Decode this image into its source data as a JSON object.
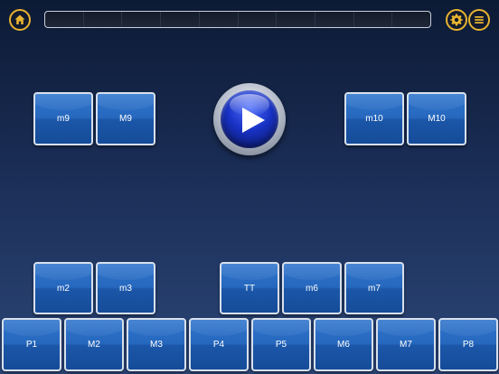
{
  "toolbar": {
    "home_icon": "home-icon",
    "settings_icon": "gear-icon",
    "menu_icon": "hamburger-menu-icon",
    "accent_color": "#e8b430",
    "progress_segments": 10,
    "progress_value": 0
  },
  "play": {
    "icon": "play-icon"
  },
  "intervals": {
    "top_left": [
      "m9",
      "M9"
    ],
    "top_right": [
      "m10",
      "M10"
    ],
    "middle_left": [
      "m2",
      "m3"
    ],
    "middle_right": [
      "TT",
      "m6",
      "m7"
    ],
    "bottom": [
      "P1",
      "M2",
      "M3",
      "P4",
      "P5",
      "M6",
      "M7",
      "P8"
    ]
  }
}
